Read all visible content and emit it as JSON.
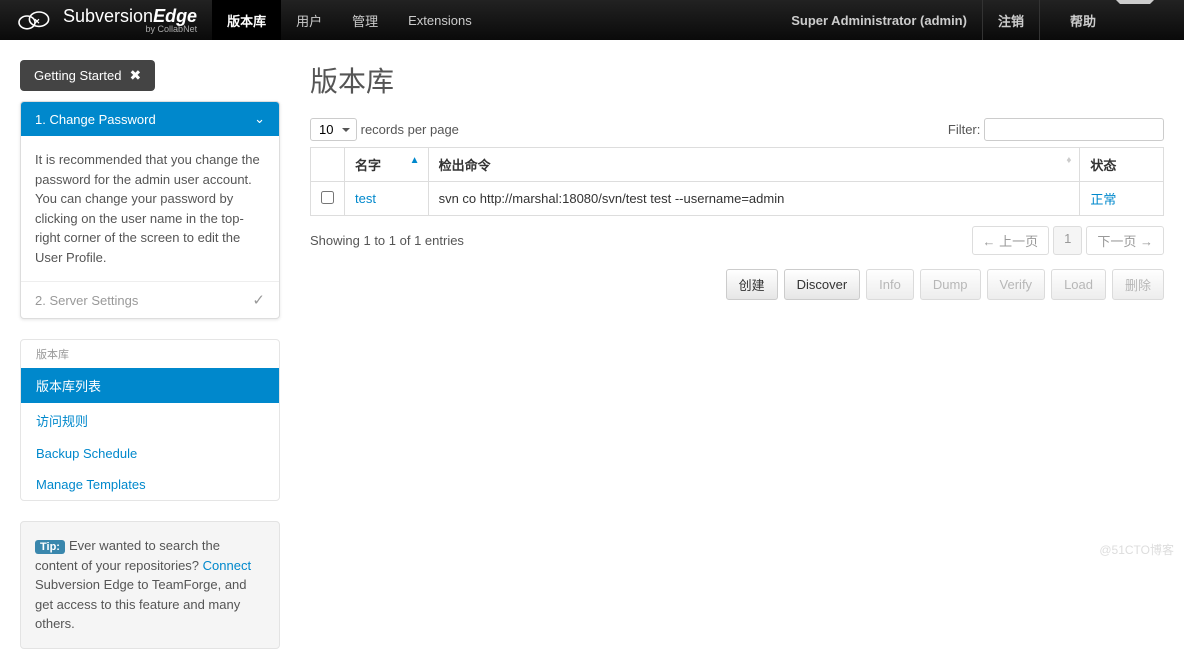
{
  "brand": {
    "name": "Subversion",
    "suffix": "Edge",
    "by": "by CollabNet"
  },
  "nav": {
    "items": [
      "版本库",
      "用户",
      "管理",
      "Extensions"
    ],
    "active_index": 0,
    "user": "Super Administrator (admin)",
    "logout": "注销",
    "help": "帮助"
  },
  "getting_started": {
    "label": "Getting Started",
    "step1_label": "1. Change Password",
    "step1_body": "It is recommended that you change the password for the admin user account. You can change your password by clicking on the user name in the top-right corner of the screen to edit the User Profile.",
    "step2_label": "2. Server Settings"
  },
  "side_menu": {
    "header": "版本库",
    "items": [
      "版本库列表",
      "访问规则",
      "Backup Schedule",
      "Manage Templates"
    ],
    "active_index": 0
  },
  "tip": {
    "badge": "Tip:",
    "text_before": "Ever wanted to search the content of your repositories? ",
    "link": "Connect",
    "text_after": " Subversion Edge to TeamForge, and get access to this feature and many others."
  },
  "page": {
    "title": "版本库",
    "records_select": "10",
    "records_label": "records per page",
    "filter_label": "Filter:",
    "filter_value": "",
    "columns": [
      "",
      "名字",
      "检出命令",
      "状态"
    ],
    "rows": [
      {
        "name": "test",
        "checkout": "svn co http://marshal:18080/svn/test test --username=admin",
        "status": "正常"
      }
    ],
    "showing": "Showing 1 to 1 of 1 entries",
    "prev": "← 上一页",
    "page_num": "1",
    "next": "下一页 →",
    "buttons": {
      "create": "创建",
      "discover": "Discover",
      "info": "Info",
      "dump": "Dump",
      "verify": "Verify",
      "load": "Load",
      "delete": "删除"
    }
  },
  "watermark": "@51CTO博客"
}
